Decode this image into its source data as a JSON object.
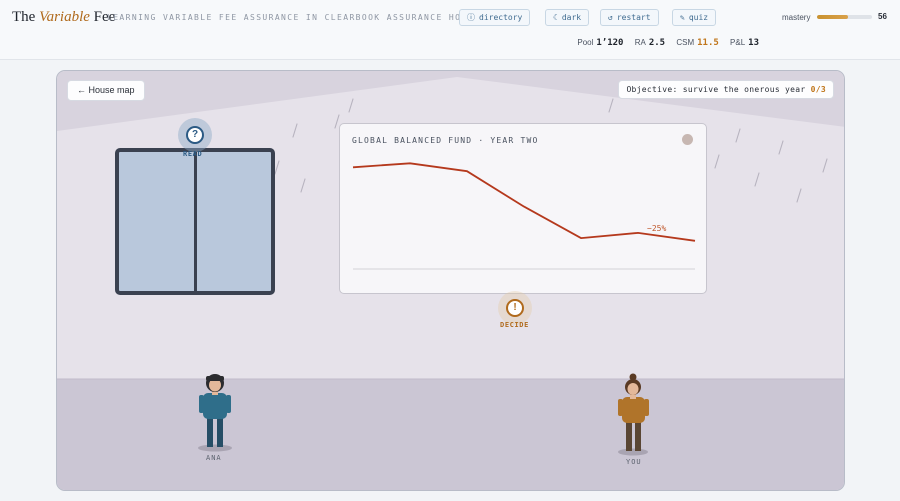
{
  "header": {
    "brand_prefix": "The",
    "brand_em": "Variable",
    "brand_suffix": "Fee",
    "tagline": "LEARNING VARIABLE FEE ASSURANCE IN CLEARBOOK ASSURANCE HOUSE",
    "buttons": [
      {
        "icon": "ⓘ",
        "label": "directory"
      },
      {
        "icon": "☾",
        "label": "dark"
      },
      {
        "icon": "↺",
        "label": "restart"
      },
      {
        "icon": "✎",
        "label": "quiz"
      }
    ],
    "mastery_label": "mastery",
    "mastery_value": "56",
    "mastery_fraction": 0.56
  },
  "stats": {
    "pool_label": "Pool",
    "pool_value": "1’120",
    "ra_label": "RA",
    "ra_value": "2.5",
    "csm_label": "CSM",
    "csm_value": "11.5",
    "pl_label": "P&L",
    "pl_value": "13"
  },
  "scene": {
    "map_button": "← House map",
    "objective_text": "Objective: survive the onerous year",
    "objective_progress": "0/3",
    "read_icon": "?",
    "read_label": "READ",
    "decide_icon": "!",
    "decide_label": "DECIDE",
    "characters": [
      {
        "name": "ANA",
        "shirt": "#2f6e8a",
        "pants": "#264e66",
        "hair": "#2b2b2f"
      },
      {
        "name": "YOU",
        "shirt": "#b0742a",
        "pants": "#5a4634",
        "hair": "#5a3a24"
      }
    ]
  },
  "board": {
    "title": "GLOBAL BALANCED FUND · YEAR TWO",
    "annotation": "−25%",
    "line_color": "#b5391d",
    "series": [
      100,
      101.5,
      98.5,
      85,
      73,
      75,
      72
    ]
  }
}
